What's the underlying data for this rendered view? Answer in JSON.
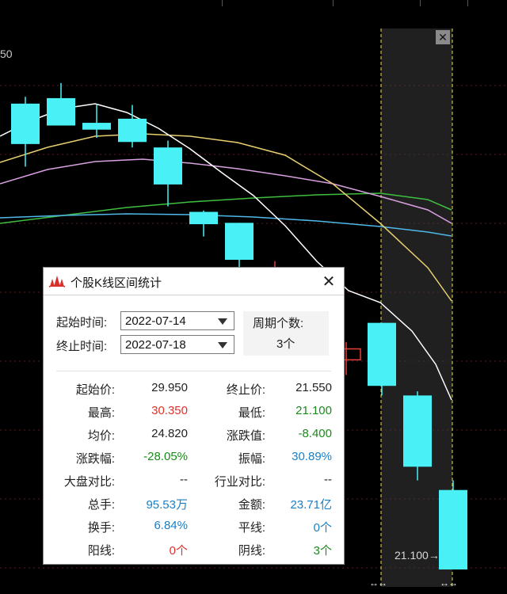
{
  "chart": {
    "price_label_left": "50",
    "last_price_tag": "21.100→",
    "candles": [
      {
        "o": 29.95,
        "c": 32.9,
        "h": 33.4,
        "l": 28.3,
        "color": "cyan"
      },
      {
        "o": 31.3,
        "c": 33.3,
        "h": 34.4,
        "l": 31.3,
        "color": "cyan"
      },
      {
        "o": 31.0,
        "c": 31.5,
        "h": 32.8,
        "l": 30.4,
        "color": "cyan"
      },
      {
        "o": 30.1,
        "c": 31.8,
        "h": 32.8,
        "l": 29.7,
        "color": "cyan"
      },
      {
        "o": 27.0,
        "c": 29.7,
        "h": 30.2,
        "l": 25.4,
        "color": "cyan"
      },
      {
        "o": 24.1,
        "c": 25.0,
        "h": 25.1,
        "l": 23.2,
        "color": "cyan"
      },
      {
        "o": 21.5,
        "c": 24.2,
        "h": 24.2,
        "l": 20.6,
        "color": "cyan"
      },
      {
        "o": 19.4,
        "c": 19.8,
        "h": 21.4,
        "l": 19.3,
        "color": "red"
      },
      {
        "o": 18.1,
        "c": 19.4,
        "h": 19.4,
        "l": 17.6,
        "color": "cyan"
      },
      {
        "o": 14.2,
        "c": 15.0,
        "h": 15.5,
        "l": 13.1,
        "color": "red"
      },
      {
        "o": 12.3,
        "c": 16.9,
        "h": 16.9,
        "l": 11.6,
        "color": "cyan"
      },
      {
        "o": 6.4,
        "c": 11.6,
        "h": 11.9,
        "l": 5.4,
        "color": "cyan"
      },
      {
        "o": -1.1,
        "c": 4.7,
        "h": 5.4,
        "l": -1.1,
        "color": "cyan"
      }
    ]
  },
  "dialog": {
    "title": "个股K线区间统计",
    "start_label": "起始时间:",
    "start_value": "2022-07-14",
    "end_label": "终止时间:",
    "end_value": "2022-07-18",
    "period_label": "周期个数:",
    "period_value": "3个",
    "rows": [
      {
        "k1": "起始价:",
        "v1": "29.950",
        "c1": "#222222",
        "k2": "终止价:",
        "v2": "21.550",
        "c2": "#222222"
      },
      {
        "k1": "最高:",
        "v1": "30.350",
        "c1": "#e0302a",
        "k2": "最低:",
        "v2": "21.100",
        "c2": "#1a8a1a"
      },
      {
        "k1": "均价:",
        "v1": "24.820",
        "c1": "#222222",
        "k2": "涨跌值:",
        "v2": "-8.400",
        "c2": "#1a8a1a"
      },
      {
        "k1": "涨跌幅:",
        "v1": "-28.05%",
        "c1": "#1a8a1a",
        "k2": "振幅:",
        "v2": "30.89%",
        "c2": "#1a7fc4"
      },
      {
        "k1": "大盘对比:",
        "v1": "--",
        "c1": "#222222",
        "k2": "行业对比:",
        "v2": "--",
        "c2": "#222222"
      },
      {
        "k1": "总手:",
        "v1": "95.53万",
        "c1": "#1a7fc4",
        "k2": "金额:",
        "v2": "23.71亿",
        "c2": "#1a7fc4"
      },
      {
        "k1": "换手:",
        "v1": "6.84%",
        "c1": "#1a7fc4",
        "k2": "平线:",
        "v2": "0个",
        "c2": "#1a7fc4"
      },
      {
        "k1": "阳线:",
        "v1": "0个",
        "c1": "#e0302a",
        "k2": "阴线:",
        "v2": "3个",
        "c2": "#1a8a1a"
      }
    ]
  }
}
